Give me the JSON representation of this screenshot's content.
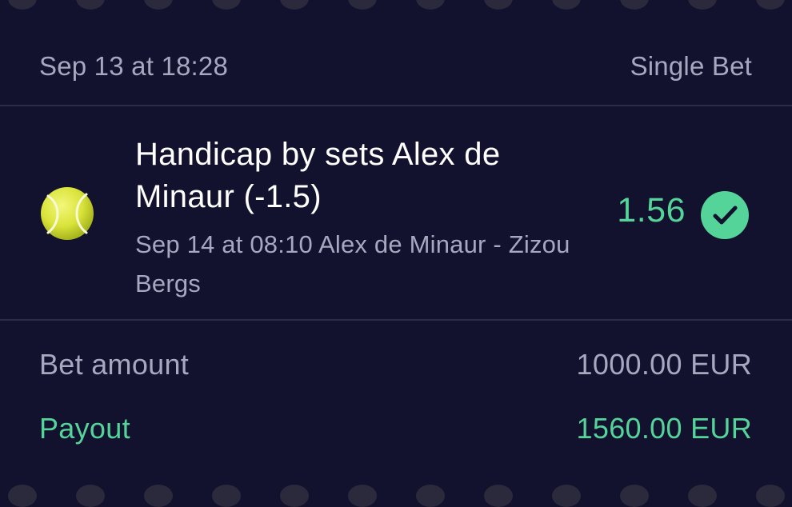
{
  "header": {
    "placed_at": "Sep 13 at 18:28",
    "bet_type": "Single Bet"
  },
  "selection": {
    "sport_icon": "tennis-ball-icon",
    "market": "Handicap by sets Alex de Minaur (-1.5)",
    "event": "Sep 14 at 08:10 Alex de Minaur - Zizou Bergs",
    "odds": "1.56",
    "status_icon": "check-circle-icon"
  },
  "summary": {
    "bet_amount_label": "Bet amount",
    "bet_amount_value": "1000.00 EUR",
    "payout_label": "Payout",
    "payout_value": "1560.00 EUR"
  },
  "colors": {
    "background": "#12112e",
    "muted_text": "#a7a7c0",
    "win_green": "#55d49a",
    "divider": "#2b2b4a"
  }
}
